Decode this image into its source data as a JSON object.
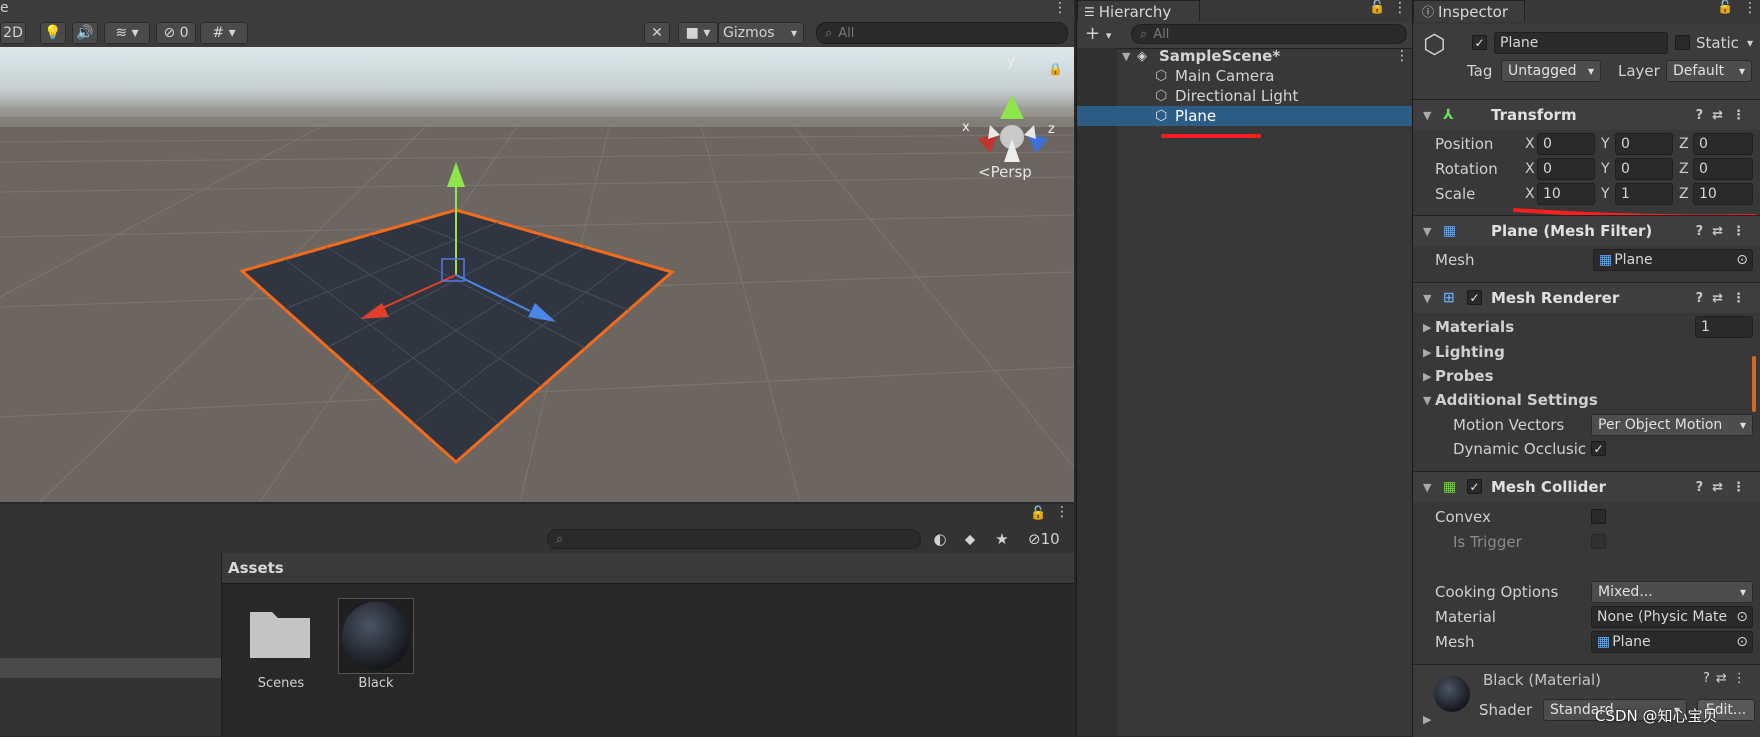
{
  "scene_toolbar": {
    "title_fragment": "e",
    "mode_2d": "2D",
    "hidden_count": "0",
    "gizmos_label": "Gizmos",
    "search_placeholder": "All",
    "persp_label": "<Persp",
    "axis_x": "x",
    "axis_y": "y",
    "axis_z": "z"
  },
  "project": {
    "hidden_count": "10",
    "assets_header": "Assets",
    "items": [
      {
        "label": "Scenes",
        "icon": "folder-icon"
      },
      {
        "label": "Black",
        "icon": "material-sphere-icon"
      }
    ]
  },
  "hierarchy": {
    "tab_label": "Hierarchy",
    "search_placeholder": "All",
    "scene_name": "SampleScene*",
    "items": [
      "Main Camera",
      "Directional Light",
      "Plane"
    ],
    "selected": "Plane"
  },
  "inspector": {
    "tab_label": "Inspector",
    "object_name": "Plane",
    "static_label": "Static",
    "tag_label": "Tag",
    "tag_value": "Untagged",
    "layer_label": "Layer",
    "layer_value": "Default",
    "transform": {
      "title": "Transform",
      "position_label": "Position",
      "rotation_label": "Rotation",
      "scale_label": "Scale",
      "x": "X",
      "y": "Y",
      "z": "Z",
      "position": [
        "0",
        "0",
        "0"
      ],
      "rotation": [
        "0",
        "0",
        "0"
      ],
      "scale": [
        "10",
        "1",
        "10"
      ]
    },
    "mesh_filter": {
      "title": "Plane (Mesh Filter)",
      "mesh_label": "Mesh",
      "mesh_value": "Plane"
    },
    "mesh_renderer": {
      "title": "Mesh Renderer",
      "materials_label": "Materials",
      "materials_count": "1",
      "lighting_label": "Lighting",
      "probes_label": "Probes",
      "additional_label": "Additional Settings",
      "motion_vectors_label": "Motion Vectors",
      "motion_vectors_value": "Per Object Motion",
      "dynamic_occlusion_label": "Dynamic Occlusic"
    },
    "mesh_collider": {
      "title": "Mesh Collider",
      "convex_label": "Convex",
      "is_trigger_label": "Is Trigger",
      "cooking_label": "Cooking Options",
      "cooking_value": "Mixed...",
      "material_label": "Material",
      "material_value": "None (Physic Mate",
      "mesh_label": "Mesh",
      "mesh_value": "Plane"
    },
    "material": {
      "name": "Black (Material)",
      "shader_label": "Shader",
      "shader_value": "Standard",
      "edit_label": "Edit..."
    },
    "watermark": "CSDN @知心宝贝"
  },
  "colors": {
    "selection": "#2c5d87",
    "outline": "#f26b1d",
    "annotation": "#ff1f1f",
    "panel": "#383838"
  }
}
